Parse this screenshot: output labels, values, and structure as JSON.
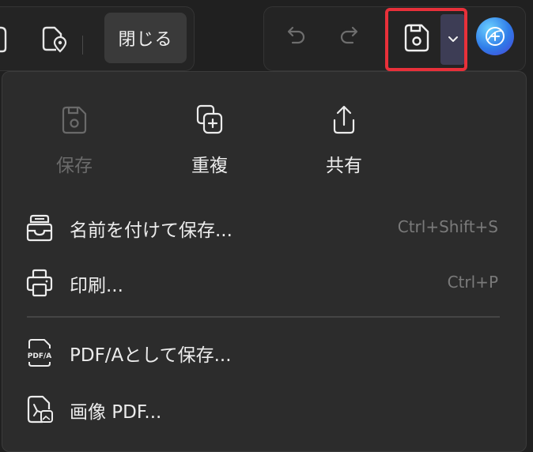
{
  "toolbar": {
    "close_label": "閉じる",
    "icons": {
      "partial_left": "document-icon",
      "location": "location-icon",
      "undo": "undo-icon",
      "redo": "redo-icon",
      "save": "save-icon",
      "dropdown": "chevron-down-icon",
      "ai": "ai-assistant-icon"
    },
    "highlight_color": "#e8303a"
  },
  "menu": {
    "top_actions": [
      {
        "label": "保存",
        "icon": "save-icon",
        "disabled": true
      },
      {
        "label": "重複",
        "icon": "duplicate-icon",
        "disabled": false
      },
      {
        "label": "共有",
        "icon": "share-icon",
        "disabled": false
      }
    ],
    "items": [
      {
        "label": "名前を付けて保存...",
        "shortcut": "Ctrl+Shift+S",
        "icon": "save-as-icon"
      },
      {
        "label": "印刷...",
        "shortcut": "Ctrl+P",
        "icon": "printer-icon"
      },
      {
        "label": "PDF/Aとして保存...",
        "shortcut": "",
        "icon": "pdfa-icon"
      },
      {
        "label": "画像 PDF...",
        "shortcut": "",
        "icon": "image-pdf-icon"
      }
    ]
  }
}
